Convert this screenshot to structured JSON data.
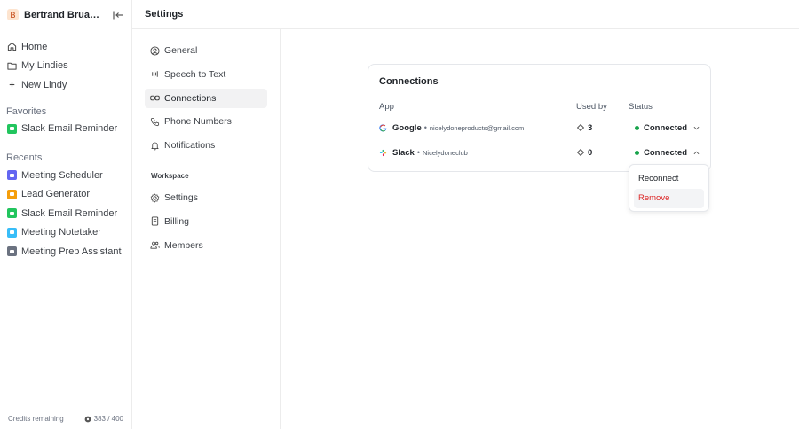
{
  "workspace": {
    "avatar_letter": "B",
    "name": "Bertrand Bruandet's..."
  },
  "sidebar": {
    "nav": [
      {
        "label": "Home",
        "icon": "home-icon"
      },
      {
        "label": "My Lindies",
        "icon": "folder-icon"
      },
      {
        "label": "New Lindy",
        "icon": "plus-icon"
      }
    ],
    "favorites_label": "Favorites",
    "favorites": [
      {
        "label": "Slack Email Reminder",
        "color": "#22c55e"
      }
    ],
    "recents_label": "Recents",
    "recents": [
      {
        "label": "Meeting Scheduler",
        "color": "#6366f1"
      },
      {
        "label": "Lead Generator",
        "color": "#f59e0b"
      },
      {
        "label": "Slack Email Reminder",
        "color": "#22c55e"
      },
      {
        "label": "Meeting Notetaker",
        "color": "#38bdf8"
      },
      {
        "label": "Meeting Prep Assistant",
        "color": "#6b7280"
      }
    ],
    "credits_label": "Credits remaining",
    "credits_value": "383 / 400"
  },
  "topbar": {
    "title": "Settings"
  },
  "settings_nav": {
    "items": [
      {
        "label": "General",
        "icon": "user-circle-icon"
      },
      {
        "label": "Speech to Text",
        "icon": "waveform-icon"
      },
      {
        "label": "Connections",
        "icon": "link-icon",
        "active": true
      },
      {
        "label": "Phone Numbers",
        "icon": "phone-icon"
      },
      {
        "label": "Notifications",
        "icon": "bell-icon"
      }
    ],
    "workspace_label": "Workspace",
    "workspace_items": [
      {
        "label": "Settings",
        "icon": "gear-icon"
      },
      {
        "label": "Billing",
        "icon": "receipt-icon"
      },
      {
        "label": "Members",
        "icon": "users-icon"
      }
    ]
  },
  "connections": {
    "title": "Connections",
    "columns": {
      "app": "App",
      "used_by": "Used by",
      "status": "Status"
    },
    "rows": [
      {
        "app": "Google",
        "account": "nicelydoneproducts@gmail.com",
        "used_by": "3",
        "status": "Connected",
        "icon": "google-icon"
      },
      {
        "app": "Slack",
        "account": "Nicelydoneclub",
        "used_by": "0",
        "status": "Connected",
        "icon": "slack-icon"
      }
    ],
    "status_color": "#16a34a"
  },
  "dropdown": {
    "items": [
      "Reconnect",
      "Remove"
    ],
    "danger_color": "#dc2626"
  }
}
